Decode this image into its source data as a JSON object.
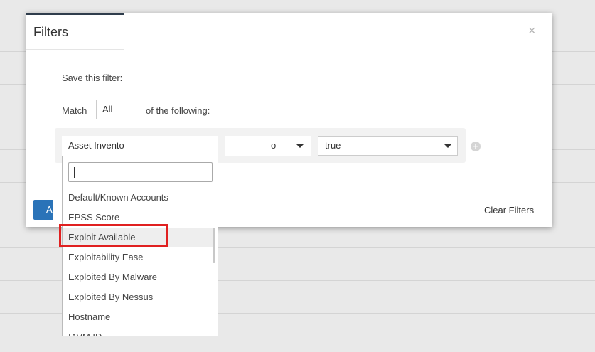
{
  "modal": {
    "title": "Filters",
    "close_glyph": "×",
    "save_label": "Save this filter:",
    "match_label": "Match",
    "match_value": "All",
    "following_label": "of the following:",
    "apply_label": "Apply",
    "clear_label": "Clear Filters"
  },
  "rule": {
    "field_value": "Asset Invento",
    "operator_value": "o",
    "value": "true",
    "add_glyph": "+"
  },
  "dropdown": {
    "search_value": "",
    "items": [
      "Default/Known Accounts",
      "EPSS Score",
      "Exploit Available",
      "Exploitability Ease",
      "Exploited By Malware",
      "Exploited By Nessus",
      "Hostname",
      "IAVM ID"
    ],
    "highlighted_index": 2
  },
  "colors": {
    "primary": "#2a73b8",
    "highlight": "#e02020",
    "accent_dark": "#2f3d4c"
  }
}
